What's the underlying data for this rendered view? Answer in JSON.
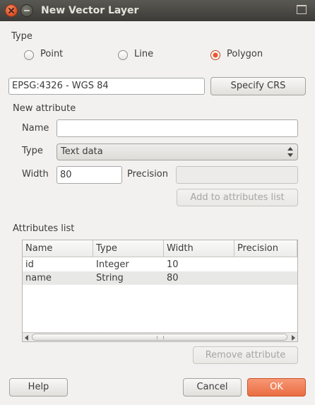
{
  "window": {
    "title": "New Vector Layer"
  },
  "type_group": {
    "label": "Type",
    "options": [
      {
        "label": "Point",
        "checked": false
      },
      {
        "label": "Line",
        "checked": false
      },
      {
        "label": "Polygon",
        "checked": true
      }
    ]
  },
  "crs": {
    "value": "EPSG:4326 - WGS 84",
    "button": "Specify CRS"
  },
  "new_attribute": {
    "heading": "New attribute",
    "name_label": "Name",
    "name_value": "",
    "type_label": "Type",
    "type_value": "Text data",
    "width_label": "Width",
    "width_value": "80",
    "precision_label": "Precision",
    "precision_value": "",
    "add_button": "Add to attributes list"
  },
  "attributes_list": {
    "heading": "Attributes list",
    "columns": [
      "Name",
      "Type",
      "Width",
      "Precision"
    ],
    "rows": [
      {
        "name": "id",
        "type": "Integer",
        "width": "10",
        "precision": ""
      },
      {
        "name": "name",
        "type": "String",
        "width": "80",
        "precision": ""
      }
    ],
    "remove_button": "Remove attribute"
  },
  "footer": {
    "help": "Help",
    "cancel": "Cancel",
    "ok": "OK"
  },
  "colors": {
    "accent": "#ea6d42",
    "window_bg": "#f2f1f0",
    "titlebar": "#3c3b37"
  }
}
